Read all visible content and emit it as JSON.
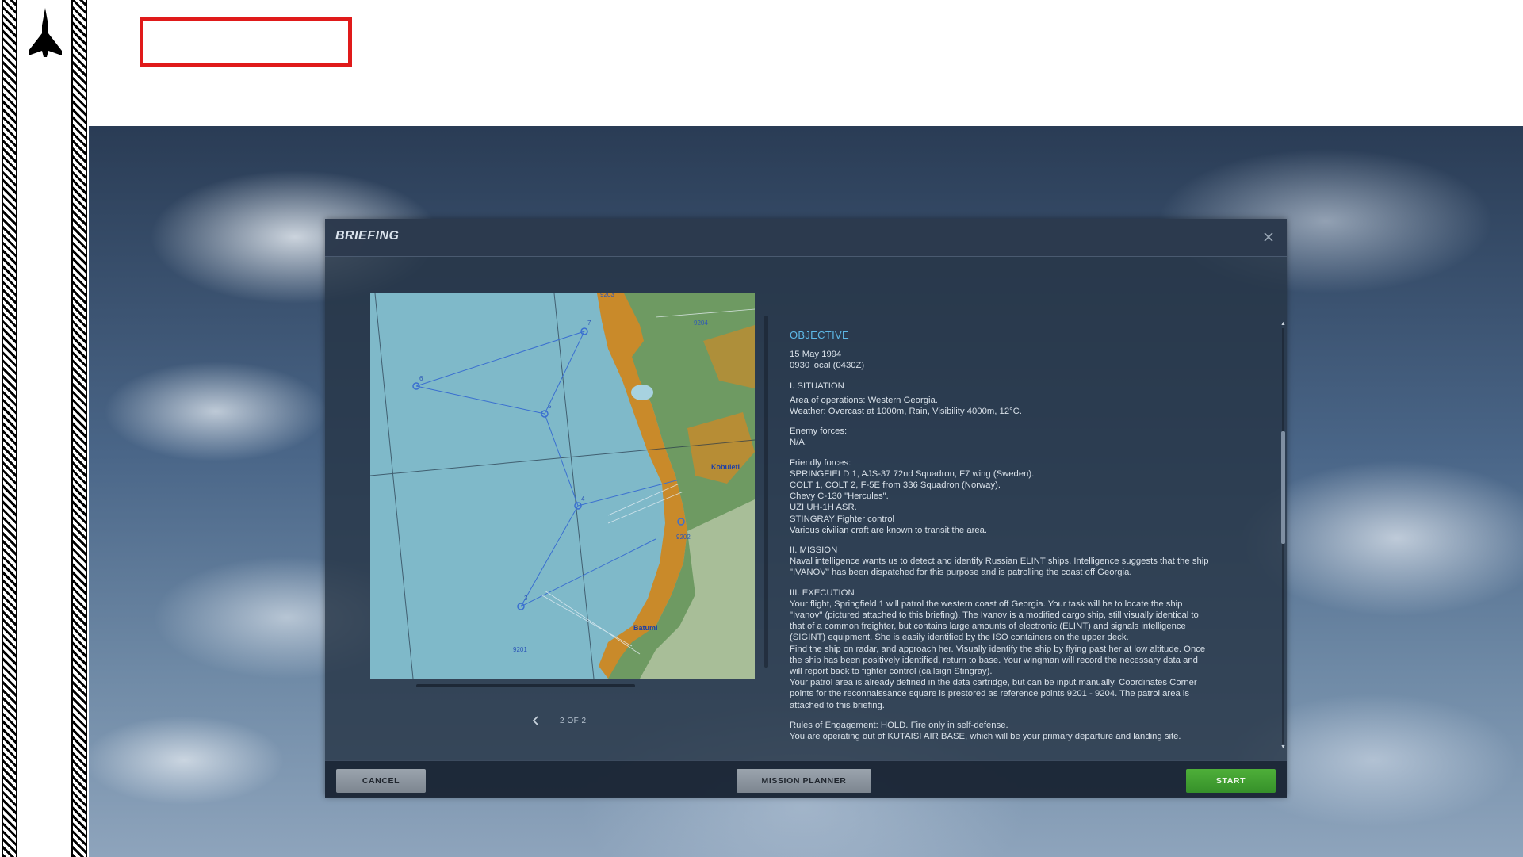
{
  "dialog": {
    "title": "BRIEFING",
    "close_icon": "close-icon"
  },
  "map": {
    "labels": {
      "kobuleti": "Kobuleti",
      "batumi": "Batumi",
      "wp_9201": "9201",
      "wp_9202": "9202",
      "wp_9203": "9203",
      "wp_9204": "9204",
      "wp_6": "6",
      "wp_5": "5",
      "wp_7": "7",
      "wp_4": "4",
      "wp_3": "3"
    }
  },
  "pager": {
    "prev_icon": "chevron-left-icon",
    "text": "2 OF 2"
  },
  "briefing": {
    "objective": "OBJECTIVE",
    "date": "15 May 1994\n0930 local (0430Z)",
    "situation_heading": "I. SITUATION",
    "situation": "Area of operations: Western Georgia.\nWeather: Overcast at 1000m, Rain, Visibility 4000m, 12°C.",
    "enemy": "Enemy forces:\nN/A.",
    "friendly": "Friendly forces:\nSPRINGFIELD 1, AJS-37 72nd Squadron, F7 wing (Sweden).\nCOLT 1, COLT 2, F-5E from 336 Squadron (Norway).\nChevy C-130 \"Hercules\".\nUZI UH-1H ASR.\nSTINGRAY Fighter control\nVarious civilian craft are known to transit the area.",
    "mission_heading": "II. MISSION",
    "mission": "Naval intelligence wants us to detect and identify Russian ELINT ships. Intelligence suggests that the ship\n\"IVANOV\" has been dispatched for this purpose and is patrolling the coast off Georgia.",
    "execution_heading": "III. EXECUTION",
    "execution": "Your flight, Springfield 1 will patrol the western coast off Georgia. Your task will be to locate the ship\n\"Ivanov\" (pictured attached to this briefing). The Ivanov is a modified cargo ship, still visually identical to\nthat of a common freighter, but contains large amounts of electronic (ELINT) and signals intelligence\n(SIGINT) equipment. She is easily identified by the ISO containers on the upper deck.\nFind the ship on radar, and approach her. Visually identify the ship by flying past her at low altitude. Once\nthe ship has been positively identified, return to base. Your wingman will record the necessary data and\nwill report back to fighter control (callsign Stingray).\nYour patrol area is already defined in the data cartridge, but can be input manually. Coordinates Corner\npoints for the reconnaissance square is prestored as reference points 9201 - 9204. The patrol area is\nattached to this briefing.",
    "roe": "Rules of Engagement: HOLD. Fire only in self-defense.\nYou are operating out of KUTAISI AIR BASE, which will be your primary departure and landing site."
  },
  "footer": {
    "cancel_label": "CANCEL",
    "planner_label": "MISSION PLANNER",
    "start_label": "START"
  },
  "colors": {
    "objective": "#5db8e6",
    "start_button": "#3f9f30",
    "redact_border": "#e01a1a",
    "sea": "#7fb9c9",
    "land_orange": "#c98a2a",
    "land_green": "#6e9a62"
  }
}
